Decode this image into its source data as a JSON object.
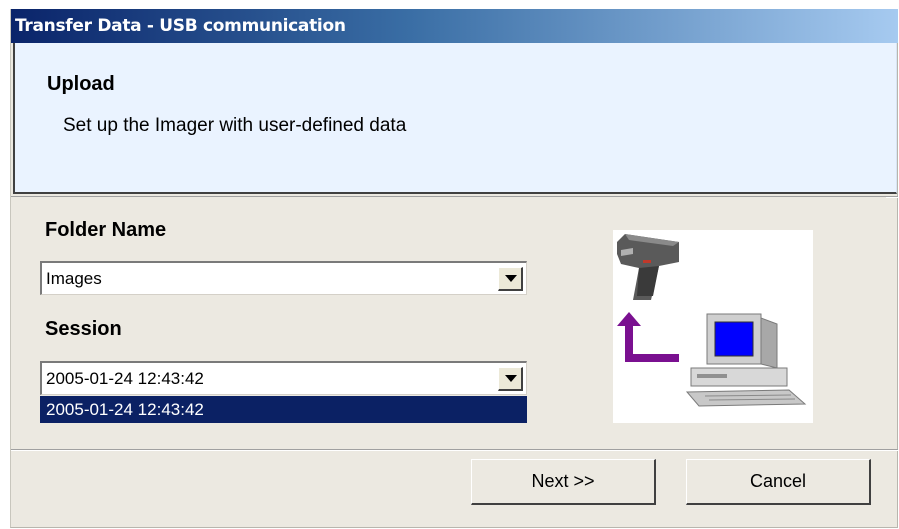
{
  "window": {
    "title": "Transfer Data - USB communication"
  },
  "header": {
    "title": "Upload",
    "description": "Set up the Imager with user-defined data"
  },
  "form": {
    "folder_label": "Folder Name",
    "folder_value": "Images",
    "session_label": "Session",
    "session_value": "2005-01-24 12:43:42",
    "session_options": [
      "2005-01-24 12:43:42"
    ]
  },
  "illustration": {
    "icons": [
      "thermal-imager-icon",
      "upload-arrow-icon",
      "computer-icon"
    ],
    "colors": {
      "arrow": "#7a1090",
      "monitor_screen": "#0000ff",
      "imager_body": "#5a5a5a"
    }
  },
  "buttons": {
    "next_label": "Next >>",
    "cancel_label": "Cancel"
  },
  "colors": {
    "title_bar": "#0a246a",
    "header_bg": "#eaf3ff",
    "selection_bg": "#0b2164",
    "dialog_bg": "#ece9e1"
  }
}
